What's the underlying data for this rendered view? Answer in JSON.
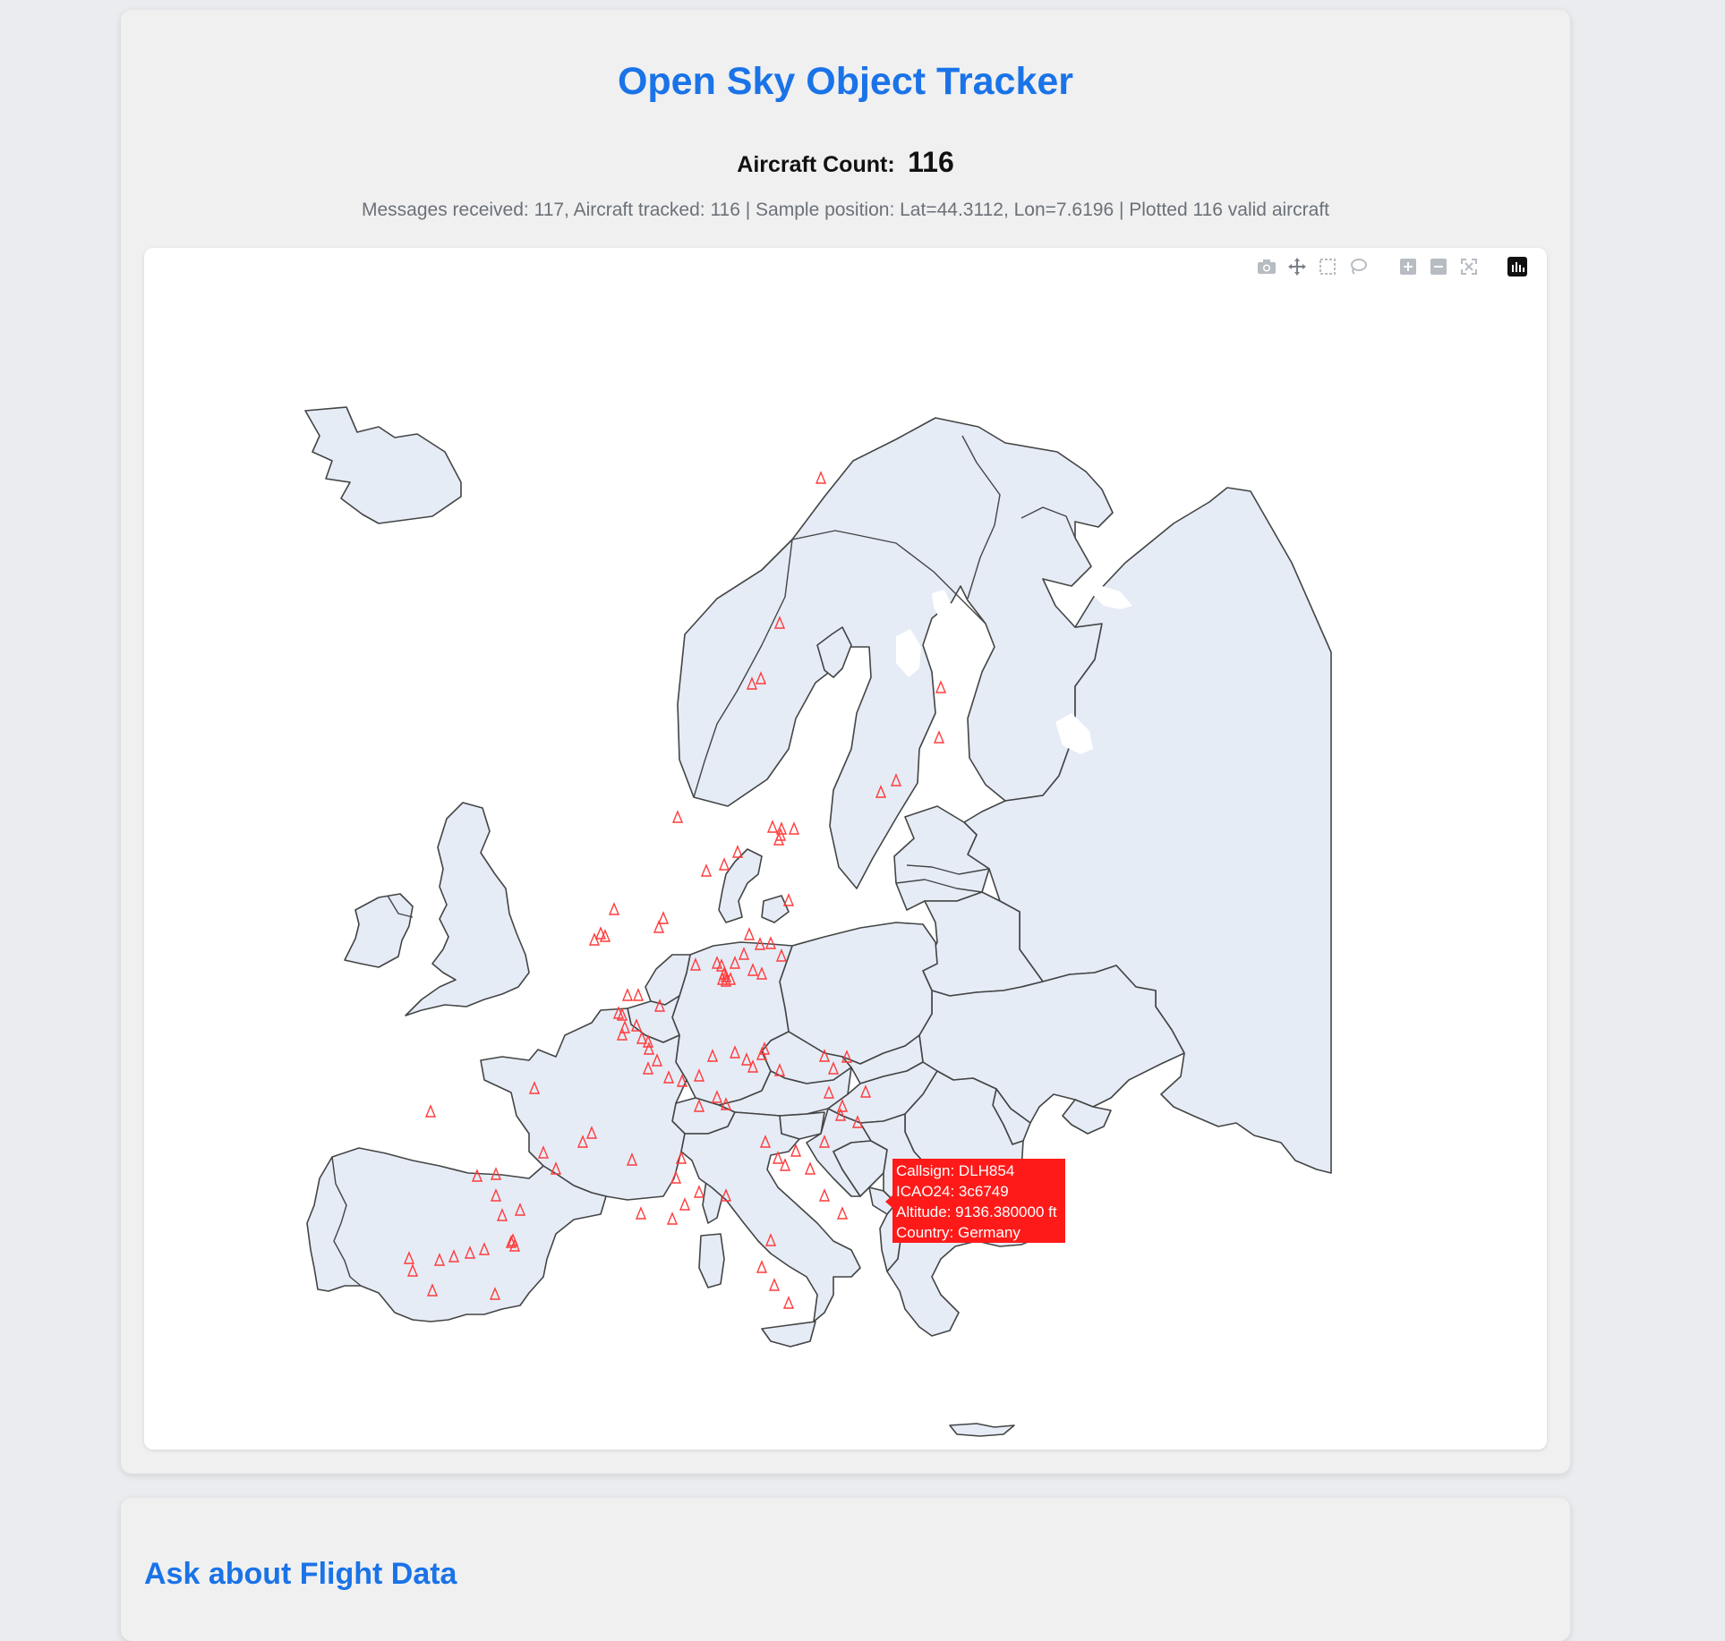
{
  "header": {
    "title": "Open Sky Object Tracker",
    "count_label": "Aircraft Count:",
    "count_value": "116",
    "status": "Messages received: 117, Aircraft tracked: 116 | Sample position: Lat=44.3112, Lon=7.6196 | Plotted 116 valid aircraft"
  },
  "modebar": {
    "buttons": [
      {
        "name": "camera-icon",
        "title": "Download plot as a png"
      },
      {
        "name": "pan-icon",
        "title": "Pan"
      },
      {
        "name": "box-select-icon",
        "title": "Box Select"
      },
      {
        "name": "lasso-select-icon",
        "title": "Lasso Select"
      },
      {
        "name": "zoom-in-icon",
        "title": "Zoom in"
      },
      {
        "name": "zoom-out-icon",
        "title": "Zoom out"
      },
      {
        "name": "reset-view-icon",
        "title": "Reset"
      },
      {
        "name": "plotly-logo-icon",
        "title": "Produced with Plotly"
      }
    ]
  },
  "map": {
    "marker_symbol": "triangle-up-open",
    "marker_color": "#ff3b3b",
    "land_color": "#e5ecf6",
    "aircraft_count": 116
  },
  "tooltip": {
    "callsign": "Callsign: DLH854",
    "icao24": "ICAO24: 3c6749",
    "altitude": "Altitude: 9136.380000 ft",
    "country": "Country: Germany",
    "color": "#ff1a1a"
  },
  "chat": {
    "title": "Ask about Flight Data"
  }
}
